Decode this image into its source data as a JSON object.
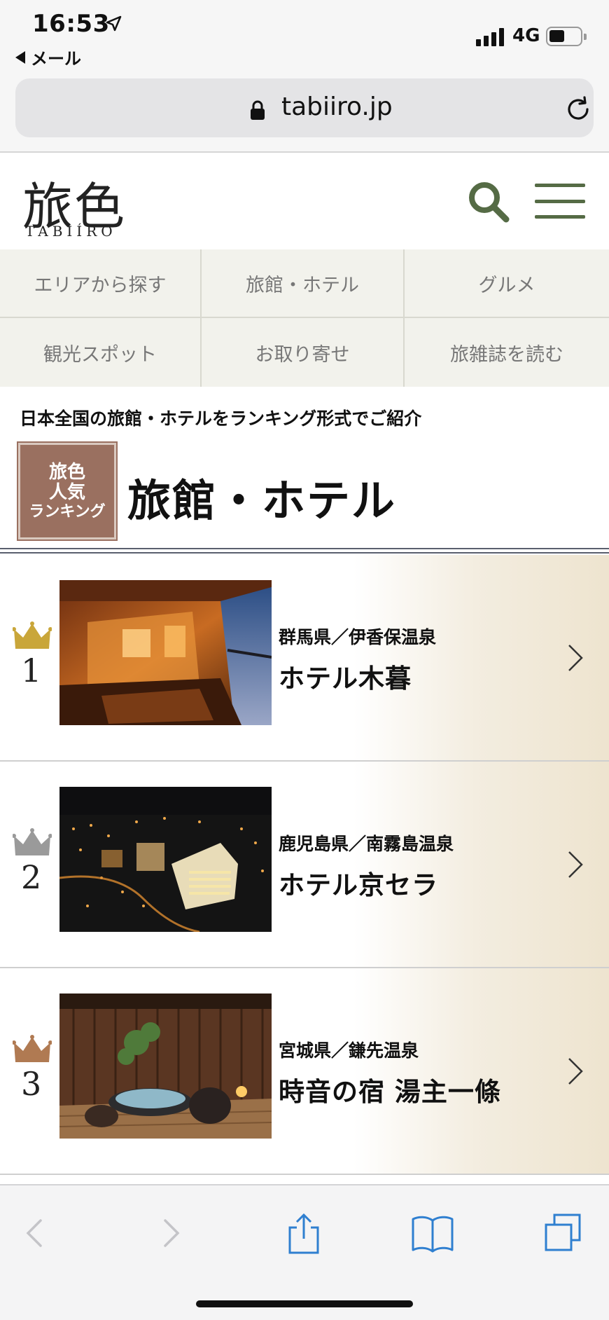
{
  "status_bar": {
    "time": "16:53",
    "back_label": "メール",
    "network": "4G",
    "battery_level": 0.5
  },
  "browser": {
    "url": "tabiiro.jp"
  },
  "site": {
    "logo_kanji": "旅色",
    "logo_roman": "TABIÍRO"
  },
  "categories": [
    {
      "label": "エリアから探す"
    },
    {
      "label": "旅館・ホテル"
    },
    {
      "label": "グルメ"
    },
    {
      "label": "観光スポット"
    },
    {
      "label": "お取り寄せ"
    },
    {
      "label": "旅雑誌を読む"
    }
  ],
  "intro": "日本全国の旅館・ホテルをランキング形式でご紹介",
  "badge": {
    "line1": "旅色",
    "line2": "人気",
    "line3": "ランキング"
  },
  "section_title": "旅館・ホテル",
  "rankings": [
    {
      "rank": "1",
      "crown_color": "#c9a63a",
      "prefecture": "群馬県／伊香保温泉",
      "name": "ホテル木暮"
    },
    {
      "rank": "2",
      "crown_color": "#9a9a9a",
      "prefecture": "鹿児島県／南霧島温泉",
      "name": "ホテル京セラ"
    },
    {
      "rank": "3",
      "crown_color": "#b07a52",
      "prefecture": "宮城県／鎌先温泉",
      "name": "時音の宿 湯主一條"
    }
  ],
  "colors": {
    "accent_green": "#556b45",
    "ios_blue": "#2f7fd0",
    "badge_brown": "#9a7060"
  }
}
